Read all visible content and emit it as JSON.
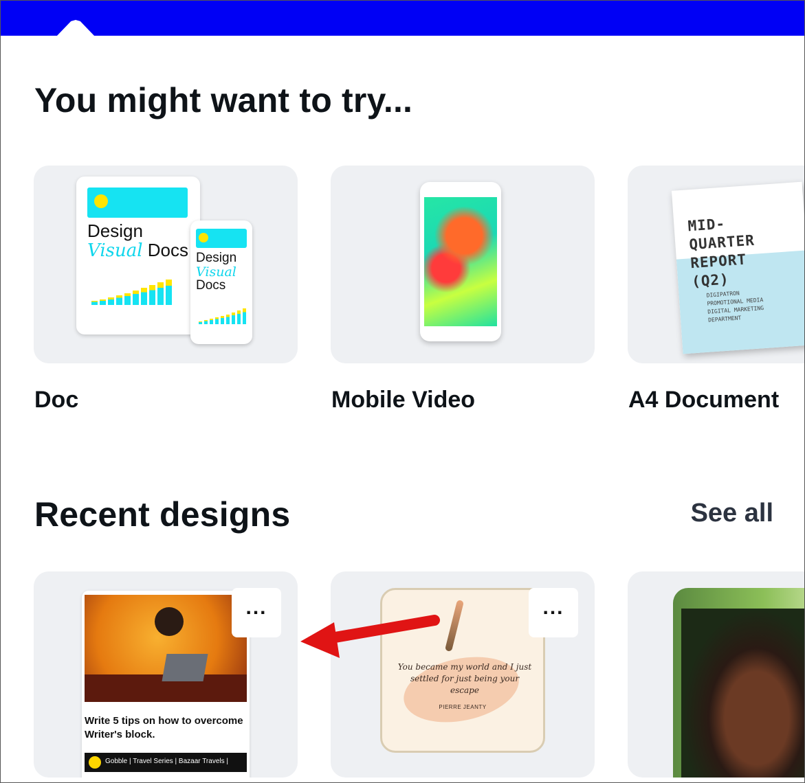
{
  "try_section": {
    "title": "You might want to try...",
    "cards": [
      {
        "label": "Doc",
        "thumb_line1": "Design",
        "thumb_visual": "Visual",
        "thumb_docs": "Docs"
      },
      {
        "label": "Mobile Video"
      },
      {
        "label": "A4 Document",
        "thumb_title": "MID-\nQUARTER\nREPORT\n(Q2)",
        "thumb_sub": "DIGIPATRON PROMOTIONAL MEDIA DIGITAL MARKETING DEPARTMENT"
      }
    ]
  },
  "recent_section": {
    "title": "Recent designs",
    "see_all": "See all",
    "more_label": "...",
    "items": [
      {
        "caption": "Write 5 tips on how to overcome Writer's block.",
        "strip_text": "Gobble | Travel Series | Bazaar Travels |"
      },
      {
        "quote": "You became my world and I just settled for just being your escape",
        "author": "PIERRE JEANTY"
      },
      {}
    ]
  },
  "colors": {
    "topbar": "#0000f5",
    "card_bg": "#eef0f3",
    "arrow": "#e01414"
  }
}
